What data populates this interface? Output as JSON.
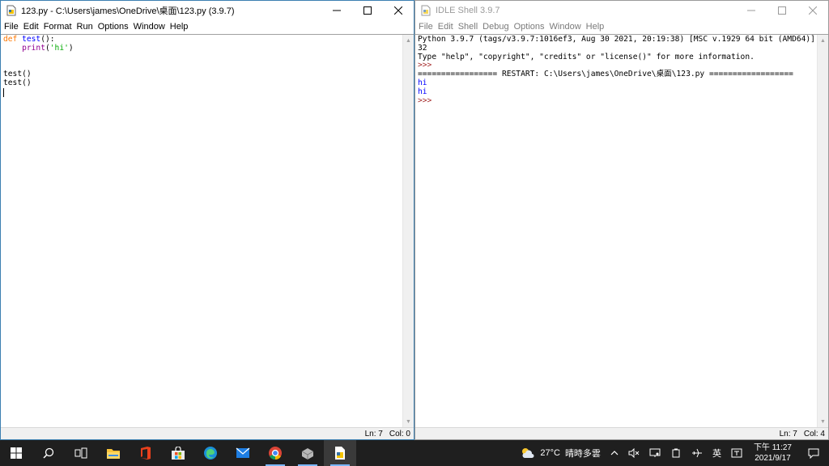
{
  "editor": {
    "title": "123.py - C:\\Users\\james\\OneDrive\\桌面\\123.py (3.9.7)",
    "menu": [
      "File",
      "Edit",
      "Format",
      "Run",
      "Options",
      "Window",
      "Help"
    ],
    "code": {
      "l1_kw": "def",
      "l1_name": "test",
      "l1_rest": "():",
      "l2_indent": "    ",
      "l2_builtin": "print",
      "l2_open": "(",
      "l2_str": "'hi'",
      "l2_close": ")",
      "l5": "test()",
      "l6": "test()"
    },
    "status": {
      "ln": "Ln: 7",
      "col": "Col: 0"
    }
  },
  "shell": {
    "title": "IDLE Shell 3.9.7",
    "menu": [
      "File",
      "Edit",
      "Shell",
      "Debug",
      "Options",
      "Window",
      "Help"
    ],
    "lines": {
      "banner1": "Python 3.9.7 (tags/v3.9.7:1016ef3, Aug 30 2021, 20:19:38) [MSC v.1929 64 bit (AMD64)] on win",
      "banner2": "32",
      "banner3": "Type \"help\", \"copyright\", \"credits\" or \"license()\" for more information.",
      "prompt1": ">>>",
      "restart": "================= RESTART: C:\\Users\\james\\OneDrive\\桌面\\123.py ==================",
      "out1": "hi",
      "out2": "hi",
      "prompt2": ">>>"
    },
    "status": {
      "ln": "Ln: 7",
      "col": "Col: 4"
    }
  },
  "taskbar": {
    "apps": [
      "windows-start-icon",
      "search-icon",
      "task-view-icon",
      "file-explorer-icon",
      "office-icon",
      "store-icon",
      "edge-icon",
      "mail-icon",
      "chrome-icon",
      "app-icon",
      "idle-icon"
    ],
    "weather": {
      "temp": "27°C",
      "desc": "晴時多雲"
    },
    "ime": "英",
    "clock": {
      "time": "下午 11:27",
      "date": "2021/9/17"
    }
  },
  "colors": {
    "keyword": "#ff7700",
    "definition": "#0000ff",
    "builtin": "#900090",
    "string": "#00aa00",
    "prompt": "#a52a2a",
    "output": "#0000ff",
    "taskbar": "#1f1f1f"
  }
}
